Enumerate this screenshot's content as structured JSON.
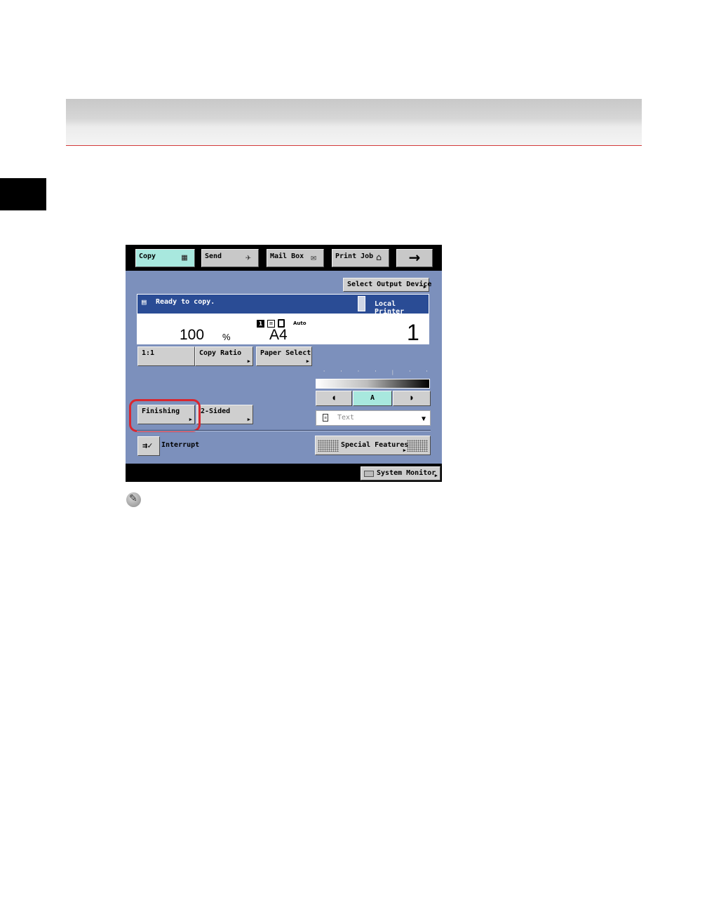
{
  "tabs": [
    {
      "label": "Copy",
      "icon": "copy-icon"
    },
    {
      "label": "Send",
      "icon": "send-icon"
    },
    {
      "label": "Mail Box",
      "icon": "mailbox-icon"
    },
    {
      "label": "Print Job",
      "icon": "print-job-icon"
    }
  ],
  "arrow_tab": "→",
  "select_output": "Select Output Device",
  "status": {
    "message": "Ready to copy.",
    "destination": "Local Printer",
    "ratio": "100",
    "ratio_unit": "%",
    "paper_size": "A4",
    "paper_mode": "Auto",
    "original_count": "1",
    "copies": "1"
  },
  "buttons": {
    "one_to_one": "1:1",
    "copy_ratio": "Copy Ratio",
    "paper_select": "Paper Select",
    "finishing": "Finishing",
    "two_sided": "2-Sided",
    "interrupt": "Interrupt",
    "special_features": "Special Features",
    "system_monitor": "System Monitor"
  },
  "density": {
    "ticks": "' ' ' ' | ' ' ' '",
    "lighter": "◖",
    "auto": "A",
    "darker": "◗"
  },
  "image_type": {
    "value": "Text"
  },
  "colors": {
    "screen_bg": "#7c90bc",
    "status_bar": "#2a4c95",
    "active_tab": "#a8e8de",
    "highlight_ring": "#d9262f"
  }
}
